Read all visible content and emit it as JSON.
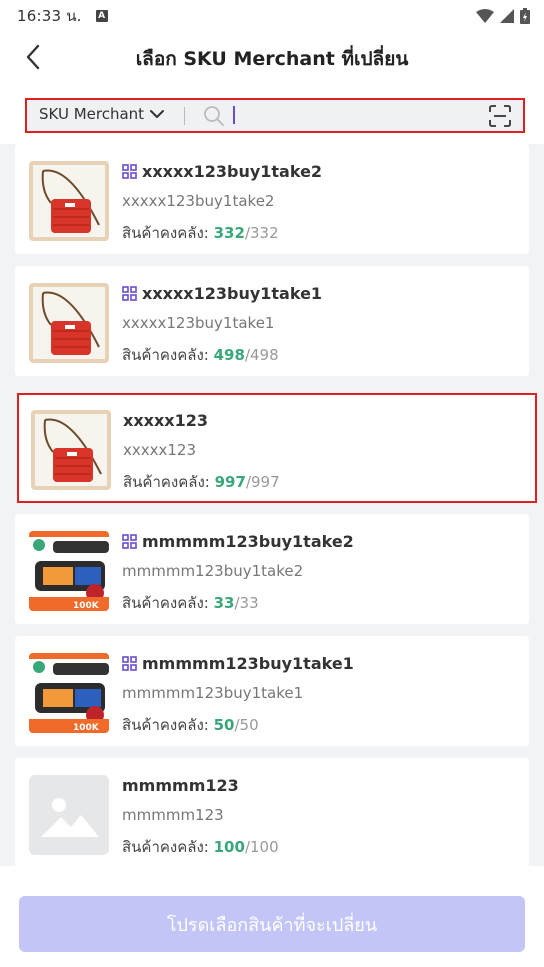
{
  "status_bar": {
    "time": "16:33 น."
  },
  "header": {
    "title": "เลือก SKU Merchant ที่เปลี่ยน"
  },
  "search": {
    "type_label": "SKU Merchant",
    "value": ""
  },
  "stock_label": "สินค้าคงคลัง:",
  "items": [
    {
      "name": "xxxxx123buy1take2",
      "sub": "xxxxx123buy1take2",
      "available": "332",
      "total": "/332",
      "bundle": true,
      "thumb": "bag",
      "selected": false
    },
    {
      "name": "xxxxx123buy1take1",
      "sub": "xxxxx123buy1take1",
      "available": "498",
      "total": "/498",
      "bundle": true,
      "thumb": "bag",
      "selected": false
    },
    {
      "name": "xxxxx123",
      "sub": "xxxxx123",
      "available": "997",
      "total": "/997",
      "bundle": false,
      "thumb": "bag",
      "selected": true
    },
    {
      "name": "mmmmm123buy1take2",
      "sub": "mmmmm123buy1take2",
      "available": "33",
      "total": "/33",
      "bundle": true,
      "thumb": "promo",
      "selected": false
    },
    {
      "name": "mmmmm123buy1take1",
      "sub": "mmmmm123buy1take1",
      "available": "50",
      "total": "/50",
      "bundle": true,
      "thumb": "promo",
      "selected": false
    },
    {
      "name": "mmmmm123",
      "sub": "mmmmm123",
      "available": "100",
      "total": "/100",
      "bundle": false,
      "thumb": "placeholder",
      "selected": false
    }
  ],
  "footer": {
    "confirm_label": "โปรดเลือกสินค้าที่จะเปลี่ยน"
  },
  "colors": {
    "accent": "#6a4ccf",
    "stock_green": "#3aa77a",
    "highlight_red": "#e02020",
    "button_disabled": "#c3c5f7"
  }
}
